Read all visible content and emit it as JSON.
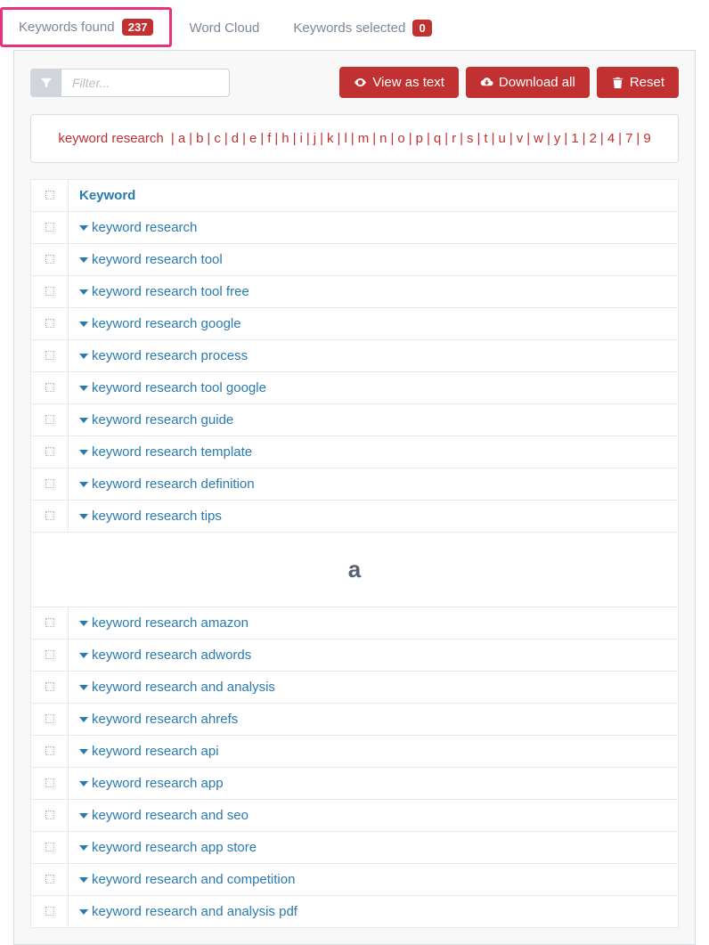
{
  "tabs": {
    "keywords_found": {
      "label": "Keywords found",
      "count": "237"
    },
    "word_cloud": {
      "label": "Word Cloud"
    },
    "keywords_selected": {
      "label": "Keywords selected",
      "count": "0"
    }
  },
  "toolbar": {
    "filter_placeholder": "Filter...",
    "view_as_text": "View as text",
    "download_all": "Download all",
    "reset": "Reset"
  },
  "az": {
    "first": "keyword research",
    "letters": [
      "a",
      "b",
      "c",
      "d",
      "e",
      "f",
      "h",
      "i",
      "j",
      "k",
      "l",
      "m",
      "n",
      "o",
      "p",
      "q",
      "r",
      "s",
      "t",
      "u",
      "v",
      "w",
      "y",
      "1",
      "2",
      "4",
      "7",
      "9"
    ]
  },
  "table": {
    "header_keyword": "Keyword",
    "group1": [
      "keyword research",
      "keyword research tool",
      "keyword research tool free",
      "keyword research google",
      "keyword research process",
      "keyword research tool google",
      "keyword research guide",
      "keyword research template",
      "keyword research definition",
      "keyword research tips"
    ],
    "section_a": "a",
    "group2": [
      "keyword research amazon",
      "keyword research adwords",
      "keyword research and analysis",
      "keyword research ahrefs",
      "keyword research api",
      "keyword research app",
      "keyword research and seo",
      "keyword research app store",
      "keyword research and competition",
      "keyword research and analysis pdf"
    ]
  }
}
